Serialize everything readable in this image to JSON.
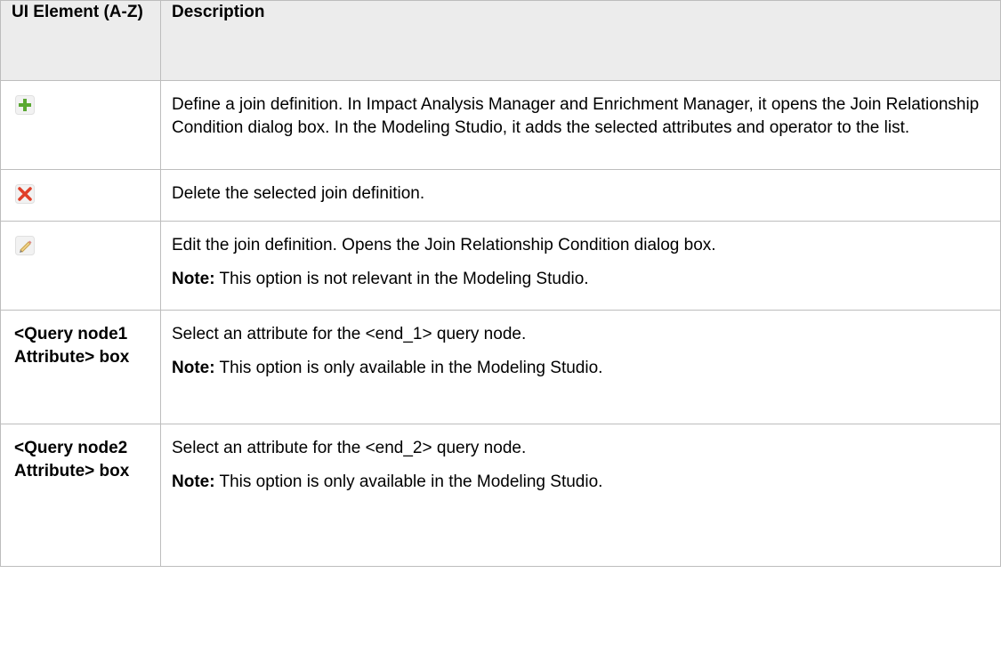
{
  "table": {
    "header": {
      "col1": "UI Element (A-Z)",
      "col2": "Description"
    },
    "rows": [
      {
        "icon": "add-icon",
        "desc": "Define a join definition. In Impact Analysis Manager and Enrichment Manager, it opens the Join Relationship Condition dialog box. In the Modeling Studio, it adds the selected attributes and operator to the list."
      },
      {
        "icon": "delete-icon",
        "desc": "Delete the selected join definition."
      },
      {
        "icon": "edit-icon",
        "desc": "Edit the join definition. Opens the Join Relationship Condition dialog box.",
        "note_label": "Note:",
        "note_text": " This option is not relevant in the Modeling Studio."
      },
      {
        "name": "<Query node1 Attribute> box",
        "desc": "Select an attribute for the <end_1> query node.",
        "note_label": "Note:",
        "note_text": " This option is only available in the Modeling Studio."
      },
      {
        "name": "<Query node2 Attribute> box",
        "desc": "Select an attribute for the <end_2> query node.",
        "note_label": "Note:",
        "note_text": " This option is only available in the Modeling Studio."
      }
    ]
  },
  "colors": {
    "header_bg": "#ececec",
    "border": "#bdbdbd",
    "add_icon_green": "#5aa832",
    "delete_icon_red": "#e0402a",
    "edit_icon_pencil": "#c9a24a"
  }
}
